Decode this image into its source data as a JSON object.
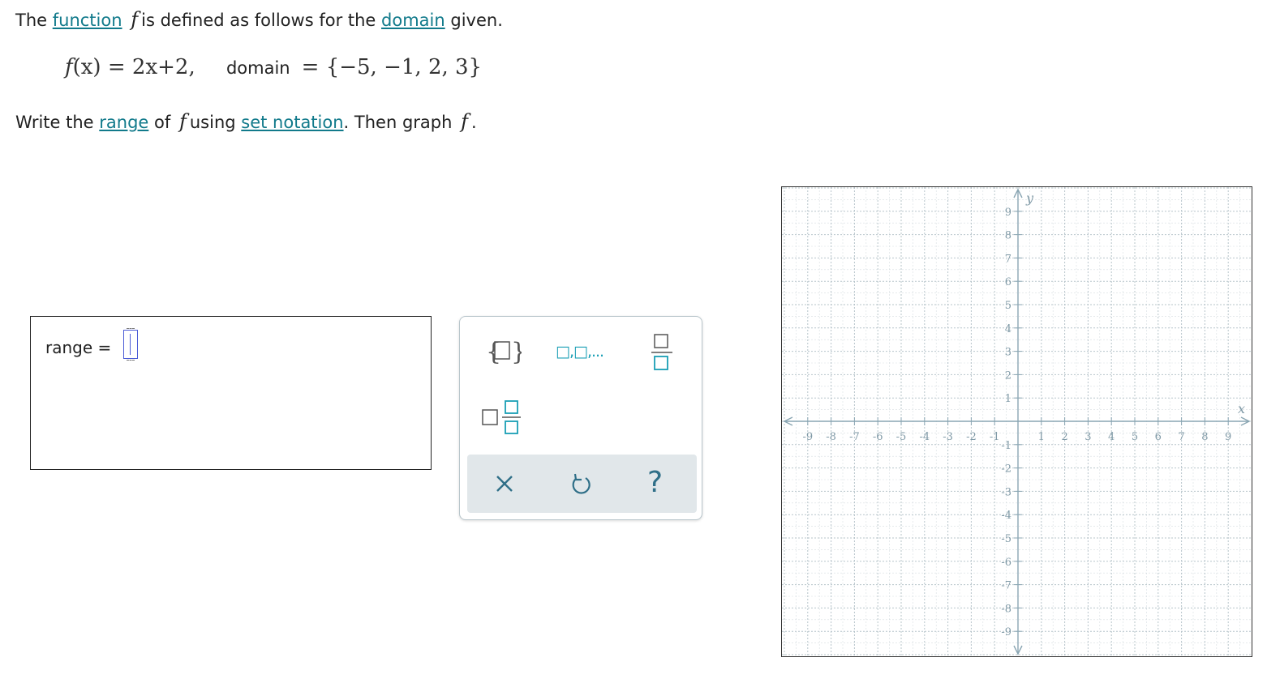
{
  "question": {
    "line1": {
      "the": "The",
      "function_link": "function",
      "f": "f",
      "rest": "is defined as follows for the",
      "domain_link": "domain",
      "given": "given."
    },
    "formula": {
      "lhs": "f",
      "lhs_arg": "(x)",
      "equals": "=",
      "rhs": "2x+2,",
      "domain_label": "domain",
      "domain_eq": "=",
      "domain_set": "{−5, −1, 2, 3}"
    },
    "line3": {
      "write": "Write the",
      "range_link": "range",
      "of": "of",
      "f": "f",
      "using": "using",
      "set_notation_link": "set notation",
      "then": ". Then graph",
      "f2": "f",
      "period": "."
    }
  },
  "answer": {
    "range_label": "range =",
    "input_value": ""
  },
  "palette": {
    "set_icon": "set-braces-icon",
    "list_text": "□,□,...",
    "fraction_icon": "fraction-icon",
    "mixed_number_icon": "mixed-number-icon",
    "clear_icon": "close-icon",
    "undo_icon": "undo-icon",
    "help_glyph": "?"
  },
  "graph": {
    "x_axis_label": "x",
    "y_axis_label": "y",
    "x_ticks": [
      "-9",
      "-8",
      "-7",
      "-6",
      "-5",
      "-4",
      "-3",
      "-2",
      "-1",
      "1",
      "2",
      "3",
      "4",
      "5",
      "6",
      "7",
      "8",
      "9"
    ],
    "y_ticks": [
      "9",
      "8",
      "7",
      "6",
      "5",
      "4",
      "3",
      "2",
      "1",
      "-1",
      "-2",
      "-3",
      "-4",
      "-5",
      "-6",
      "-7",
      "-8",
      "-9"
    ],
    "colors": {
      "axis": "#8aa6b3",
      "grid": "#b0bec5",
      "tick_label": "#7f99a6",
      "border": "#333333"
    }
  },
  "colors": {
    "link": "#117a8b",
    "palette_teal": "#1a9fb5",
    "palette_action_bg": "#e1e7ea"
  }
}
